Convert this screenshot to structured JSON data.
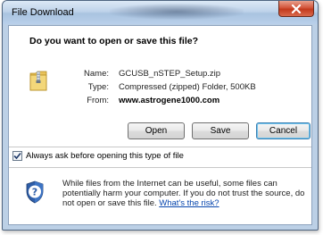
{
  "window": {
    "title": "File Download",
    "close_symbol": "x"
  },
  "dialog": {
    "question": "Do you want to open or save this file?",
    "file": {
      "icon": "zip-folder-icon",
      "name_label": "Name:",
      "name_value": "GCUSB_nSTEP_Setup.zip",
      "type_label": "Type:",
      "type_value": "Compressed (zipped) Folder, 500KB",
      "from_label": "From:",
      "from_value": "www.astrogene1000.com"
    },
    "buttons": {
      "open": "Open",
      "save": "Save",
      "cancel": "Cancel"
    },
    "checkbox": {
      "label": "Always ask before opening this type of file",
      "checked": true
    },
    "warning": {
      "icon": "security-shield-icon",
      "text": "While files from the Internet can be useful, some files can potentially harm your computer. If you do not trust the source, do not open or save this file.",
      "link": "What's the risk?"
    }
  }
}
